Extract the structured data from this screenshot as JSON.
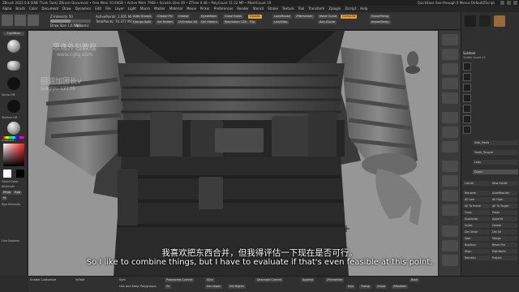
{
  "titlebar": {
    "text": "ZBrush 2022.0.8 [ENE Think Tank]   ZBrush Document   • Free Mem 10.94GB • Active Mem 7968 • Scratch Disk 49 • ZTime 0.48 • PolyCount 11.52 MP • MeshCount 19",
    "right": "QuickSave  See-through 0  Menus  DefaultZScript"
  },
  "menus": [
    "Alpha",
    "Brush",
    "Color",
    "Document",
    "Draw",
    "Dynamics",
    "Edit",
    "File",
    "Layer",
    "Light",
    "Macro",
    "Marker",
    "Material",
    "Movie",
    "Picker",
    "Preferences",
    "Render",
    "Stencil",
    "Stroke",
    "Texture",
    "Tool",
    "Transform",
    "Zplugin",
    "Zscript",
    "Help"
  ],
  "toolbar": {
    "intensity_label": "Z Intensity 50",
    "focal_label": "Focal Shift 0",
    "draw_size_label": "Draw Size 1.67882",
    "dynamic_label": "Dynamic",
    "active_points": "ActivePoints: 1.005 Mil",
    "total_points": "TotalPoints: 74.377 Mil",
    "btn_auto_groups": "Auto Groups",
    "btn_groups_split": "Groups Split",
    "btn_crease_pg": "Crease PG",
    "btn_sel_hidden": "Sel Hidden",
    "btn_crease": "Crease",
    "btn_uncrease_all": "UnCrease All",
    "btn_del_hidden": "Del Hidden",
    "btn_dynamesh": "DynaMesh",
    "btn_close_holes": "Close Holes",
    "btn_resolution": "Resolution 128",
    "btn_double": "Double",
    "btn_flip": "Flip",
    "btn_lazymouse": "LazyMouse",
    "btn_lazystep": "LazyStep",
    "btn_zremesher": "ZRemesher",
    "btn_move_curve": "Move Curve",
    "btn_accucurve": "AccuCurve",
    "btn_export_temp": "ExportTemp",
    "btn_import_temp": "ImportTemp",
    "btn_gizmo": "Gizmo3D"
  },
  "leftpanel": {
    "lightbox": "LightBox",
    "alpha_off": "Alpha Off",
    "texture_off": "Texture Off",
    "gradient": "Gradient",
    "switch_color": "SwitchColor",
    "alternate": "Alternate",
    "mrgb": "Mrgb",
    "rgb": "Rgb",
    "m": "M",
    "rgb_intensity": "Rgb Intensity",
    "live_boolean": "Live Boolean"
  },
  "rightpanel": {
    "subtool_title": "Subtool",
    "visible_count": "Visible Count 20",
    "items": [
      "Side_Pants",
      "Tooth_Tongue",
      "Legs",
      "Gums"
    ],
    "buttons": [
      "Rename",
      "AutoReorder",
      "All Low",
      "All High",
      "All To Home",
      "All To Target",
      "Copy",
      "Paste",
      "Duplicate",
      "Append",
      "Insert",
      "Delete",
      "Del Other",
      "Del All",
      "Split",
      "Merge",
      "Boolean",
      "Bevel Pro",
      "Align",
      "Distribute",
      "Remesh",
      "Project"
    ],
    "list_all": "List All",
    "new_folder": "New Folder"
  },
  "bottombar": {
    "enable_customize": "Enable Customize",
    "inflate": "Inflate",
    "sym": "Sym",
    "use_poly": "Use and Keep Polygroups",
    "preprocess": "Preprocess Current",
    "tri": "Tri",
    "sdiv": "SDiv",
    "del_lower": "Del Lower",
    "del_higher": "Del Higher",
    "decimate": "Decimate Current",
    "append": "Append",
    "zremesher": "ZRemesher",
    "solo": "Solo",
    "transp": "Transp",
    "ghost": "Ghost",
    "zmodeler": "ZModeler",
    "back": "Back"
  },
  "subtitles": {
    "cn": "我喜欢把东西合并，但我得评估一下现在是否可行。",
    "en": "So I like to combine things, but I have to evaluate if that's even feasible at this point."
  },
  "watermark": {
    "line1": "思逸外包教程",
    "line2": "www.cgtg.com",
    "line3": "回调加团长v",
    "line4": "luoqiyu 12138"
  },
  "colors": {
    "accent": "#e3a23c",
    "viewport_bg": "#959595",
    "panel": "#2f2f2f"
  }
}
